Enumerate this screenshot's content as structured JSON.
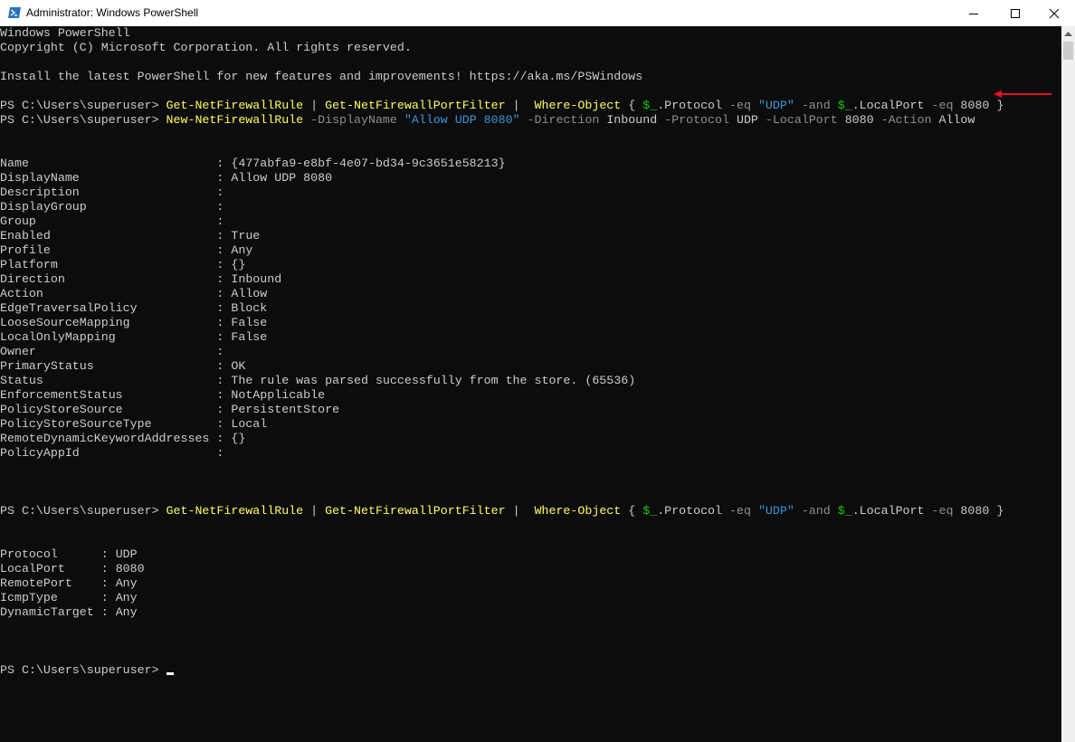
{
  "window": {
    "title": "Administrator: Windows PowerShell"
  },
  "colors": {
    "background": "#0c0c0c",
    "text": "#cccccc",
    "cmdlet": "#ffff60",
    "parameter": "#8f8f8f",
    "string": "#3a96dd",
    "variable": "#13c713",
    "arrow": "#e81123"
  },
  "icons": [
    "powershell-icon",
    "minimize-icon",
    "maximize-icon",
    "close-icon",
    "scroll-up-arrow-icon",
    "red-arrow-icon"
  ],
  "console": {
    "banner1": "Windows PowerShell",
    "banner2": "Copyright (C) Microsoft Corporation. All rights reserved.",
    "banner3": "Install the latest PowerShell for new features and improvements! https://aka.ms/PSWindows",
    "prompt": "PS C:\\Users\\superuser> ",
    "t": {
      "get_rule": "Get-NetFirewallRule",
      "pipe1": " | ",
      "get_port": "Get-NetFirewallPortFilter",
      "pipe2": " |  ",
      "where": "Where-Object",
      "brace_open": " { ",
      "dollar": "$_",
      "protocol_prop": ".Protocol ",
      "eq": "-eq",
      "udp_str": "\"UDP\"",
      "and": "-and",
      "localport_prop": ".LocalPort ",
      "num8080": "8080",
      "brace_close": " }",
      "new_rule": "New-NetFirewallRule",
      "p_display": "-DisplayName",
      "s_allow": "\"Allow UDP 8080\"",
      "p_direction": "-Direction",
      "v_inbound": "Inbound",
      "p_protocol": "-Protocol",
      "v_udp": "UDP",
      "p_localport": "-LocalPort",
      "p_action": "-Action",
      "v_allow": "Allow",
      "sp": " "
    },
    "rule_output": [
      {
        "k": "Name                          ",
        "v": "{477abfa9-e8bf-4e07-bd34-9c3651e58213}"
      },
      {
        "k": "DisplayName                   ",
        "v": "Allow UDP 8080"
      },
      {
        "k": "Description                   ",
        "v": ""
      },
      {
        "k": "DisplayGroup                  ",
        "v": ""
      },
      {
        "k": "Group                         ",
        "v": ""
      },
      {
        "k": "Enabled                       ",
        "v": "True"
      },
      {
        "k": "Profile                       ",
        "v": "Any"
      },
      {
        "k": "Platform                      ",
        "v": "{}"
      },
      {
        "k": "Direction                     ",
        "v": "Inbound"
      },
      {
        "k": "Action                        ",
        "v": "Allow"
      },
      {
        "k": "EdgeTraversalPolicy           ",
        "v": "Block"
      },
      {
        "k": "LooseSourceMapping            ",
        "v": "False"
      },
      {
        "k": "LocalOnlyMapping              ",
        "v": "False"
      },
      {
        "k": "Owner                         ",
        "v": ""
      },
      {
        "k": "PrimaryStatus                 ",
        "v": "OK"
      },
      {
        "k": "Status                        ",
        "v": "The rule was parsed successfully from the store. (65536)"
      },
      {
        "k": "EnforcementStatus             ",
        "v": "NotApplicable"
      },
      {
        "k": "PolicyStoreSource             ",
        "v": "PersistentStore"
      },
      {
        "k": "PolicyStoreSourceType         ",
        "v": "Local"
      },
      {
        "k": "RemoteDynamicKeywordAddresses ",
        "v": "{}"
      },
      {
        "k": "PolicyAppId                   ",
        "v": ""
      }
    ],
    "port_output": [
      {
        "k": "Protocol      ",
        "v": "UDP"
      },
      {
        "k": "LocalPort     ",
        "v": "8080"
      },
      {
        "k": "RemotePort    ",
        "v": "Any"
      },
      {
        "k": "IcmpType      ",
        "v": "Any"
      },
      {
        "k": "DynamicTarget ",
        "v": "Any"
      }
    ]
  }
}
